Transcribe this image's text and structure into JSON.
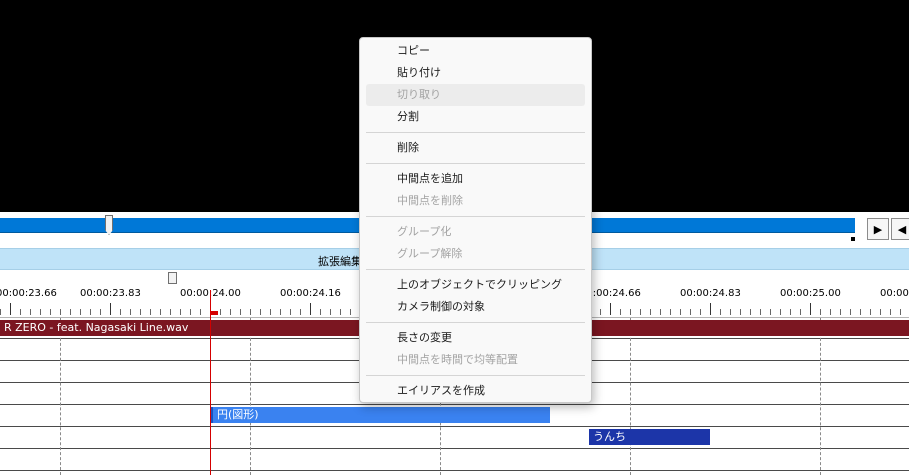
{
  "timeline": {
    "title": "拡張編集",
    "ruler_labels": [
      "00:00:23.66",
      "00:00:23.83",
      "00:00:24.00",
      "00:00:24.16",
      "00:00:24.66",
      "00:00:24.83",
      "00:00:25.00",
      "00:00:2"
    ],
    "transport": {
      "next_glyph": "▶",
      "prev_glyph": "◀"
    }
  },
  "clips": {
    "audio": "R ZERO - feat. Nagasaki Line.wav",
    "circle": "円(図形)",
    "unchi": "うんち"
  },
  "colors": {
    "seek_bar": "#0078d7",
    "header": "#bfe3f8",
    "audio_clip": "#7b1621",
    "circle_clip": "#3a82f0",
    "unchi_clip": "#1c35a8",
    "playhead": "#d40000"
  },
  "context_menu": {
    "items": [
      {
        "label": "コピー",
        "enabled": true
      },
      {
        "label": "貼り付け",
        "enabled": true
      },
      {
        "label": "切り取り",
        "enabled": false
      },
      {
        "label": "分割",
        "enabled": true
      },
      {
        "label": "削除",
        "enabled": true
      },
      {
        "label": "中間点を追加",
        "enabled": true
      },
      {
        "label": "中間点を削除",
        "enabled": false
      },
      {
        "label": "グループ化",
        "enabled": false
      },
      {
        "label": "グループ解除",
        "enabled": false
      },
      {
        "label": "上のオブジェクトでクリッピング",
        "enabled": true
      },
      {
        "label": "カメラ制御の対象",
        "enabled": true
      },
      {
        "label": "長さの変更",
        "enabled": true
      },
      {
        "label": "中間点を時間で均等配置",
        "enabled": false
      },
      {
        "label": "エイリアスを作成",
        "enabled": true
      }
    ]
  }
}
